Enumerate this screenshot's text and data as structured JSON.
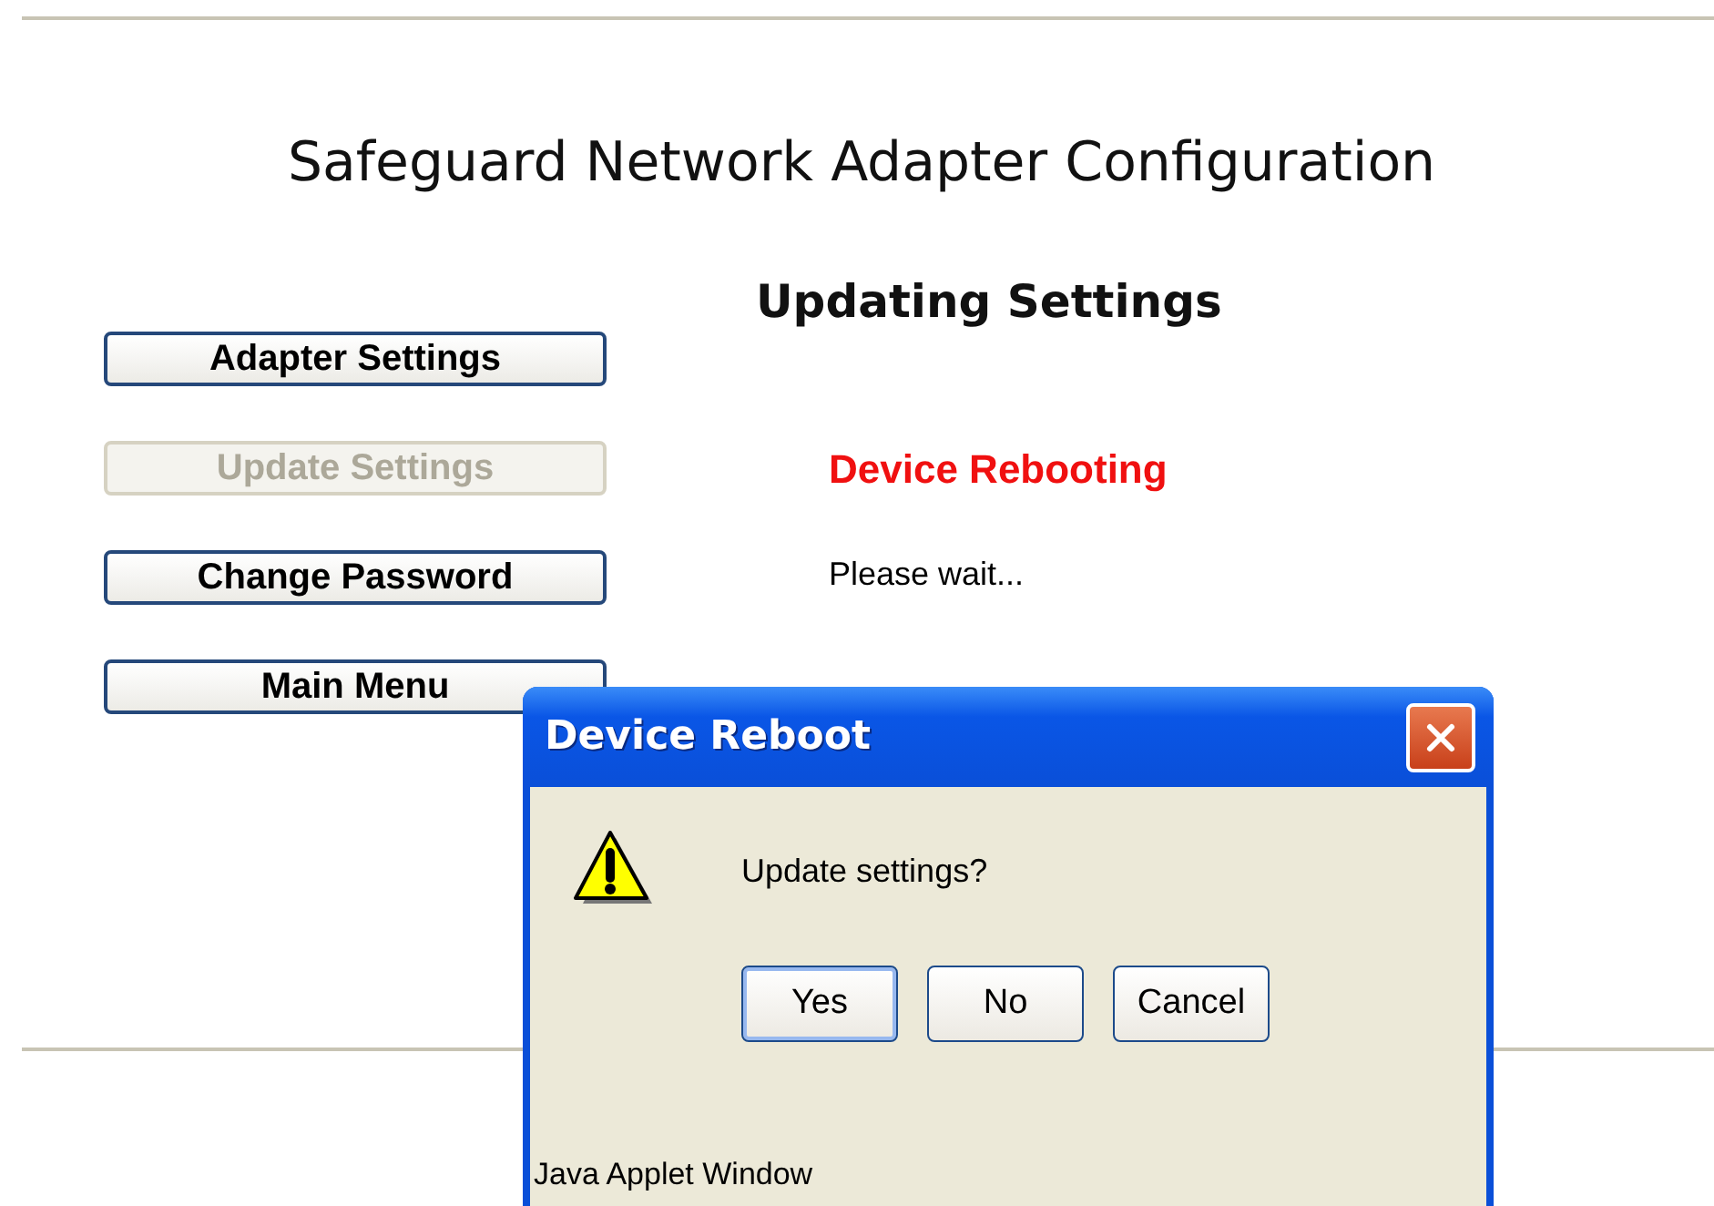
{
  "page": {
    "title": "Safeguard Network Adapter Configuration",
    "subtitle": "Updating Settings"
  },
  "nav_buttons": [
    {
      "label": "Adapter Settings",
      "disabled": false
    },
    {
      "label": "Update Settings",
      "disabled": true
    },
    {
      "label": "Change Password",
      "disabled": false
    },
    {
      "label": "Main Menu",
      "disabled": false
    }
  ],
  "status": {
    "headline": "Device Rebooting",
    "message": "Please wait..."
  },
  "dialog": {
    "title": "Device Reboot",
    "message": "Update settings?",
    "footer": "Java Applet Window",
    "buttons": [
      {
        "label": "Yes",
        "focused": true
      },
      {
        "label": "No",
        "focused": false
      },
      {
        "label": "Cancel",
        "focused": false
      }
    ]
  }
}
